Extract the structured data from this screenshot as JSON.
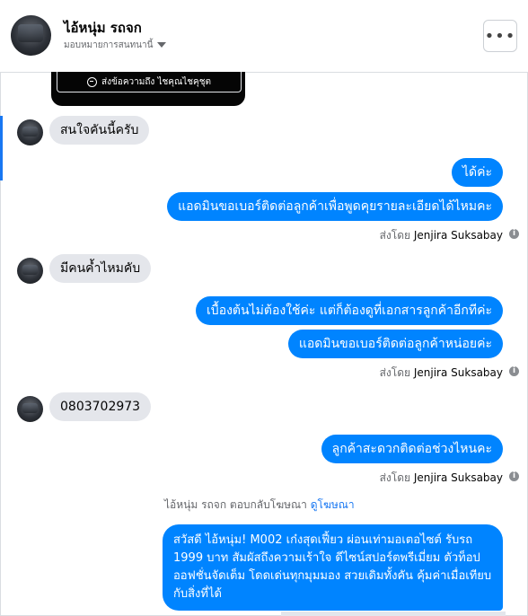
{
  "header": {
    "contact_name": "ไอ้หนุ่ม รถจก",
    "assign_label": "มอบหมายการสนทนานี้",
    "more_label": "•••"
  },
  "ad_card": {
    "button_label": "ส่งข้อความถึง ไชคุณไชคุชุต"
  },
  "messages": [
    {
      "direction": "in",
      "text": "สนใจคันนี้ครับ"
    },
    {
      "direction": "out",
      "text": "ได้ค่ะ"
    },
    {
      "direction": "out",
      "text": "แอดมินขอเบอร์ติดต่อลูกค้าเพื่อพูดคุยรายละเอียดได้ไหมคะ"
    },
    {
      "direction": "meta",
      "text": "ส่งโดย",
      "sender": "Jenjira Suksabay"
    },
    {
      "direction": "in",
      "text": "มีคนค้ำไหมคับ"
    },
    {
      "direction": "out",
      "text": "เบื้องต้นไม่ต้องใช้ค่ะ แต่ก็ต้องดูที่เอกสารลูกค้าอีกทีค่ะ"
    },
    {
      "direction": "out",
      "text": "แอดมินขอเบอร์ติดต่อลูกค้าหน่อยค่ะ"
    },
    {
      "direction": "meta",
      "text": "ส่งโดย",
      "sender": "Jenjira Suksabay"
    },
    {
      "direction": "in",
      "text": "0803702973"
    },
    {
      "direction": "out",
      "text": "ลูกค้าสะดวกติดต่อช่วงไหนคะ"
    },
    {
      "direction": "meta",
      "text": "ส่งโดย",
      "sender": "Jenjira Suksabay"
    }
  ],
  "reply_note": {
    "text": "ไอ้หนุ่ม รถจก ตอบกลับโฆษณา",
    "link": "ดูโฆษณา"
  },
  "auto_reply": {
    "text": "สวัสดี ไอ้หนุ่ม! M002 เก๋งสุดเฟี้ยว ผ่อนเท่ามอเตอไซต์ รับรถ 1999 บาท สัมผัสถึงความเร้าใจ ดีไซน์สปอร์ตพรีเมี่ยม ตัวท็อป ออฟชั่นจัดเต็ม โดดเด่นทุกมุมมอง สวยเดิมทั้งคัน คุ้มค่าเมื่อเทียบกับสิ่งที่ได้"
  },
  "colors": {
    "outgoing_bubble": "#0084ff",
    "incoming_bubble": "#e4e6eb",
    "accent": "#1877f2"
  },
  "icons": {
    "info": "i",
    "messenger": "messenger-icon",
    "caret": "caret-down-icon"
  }
}
